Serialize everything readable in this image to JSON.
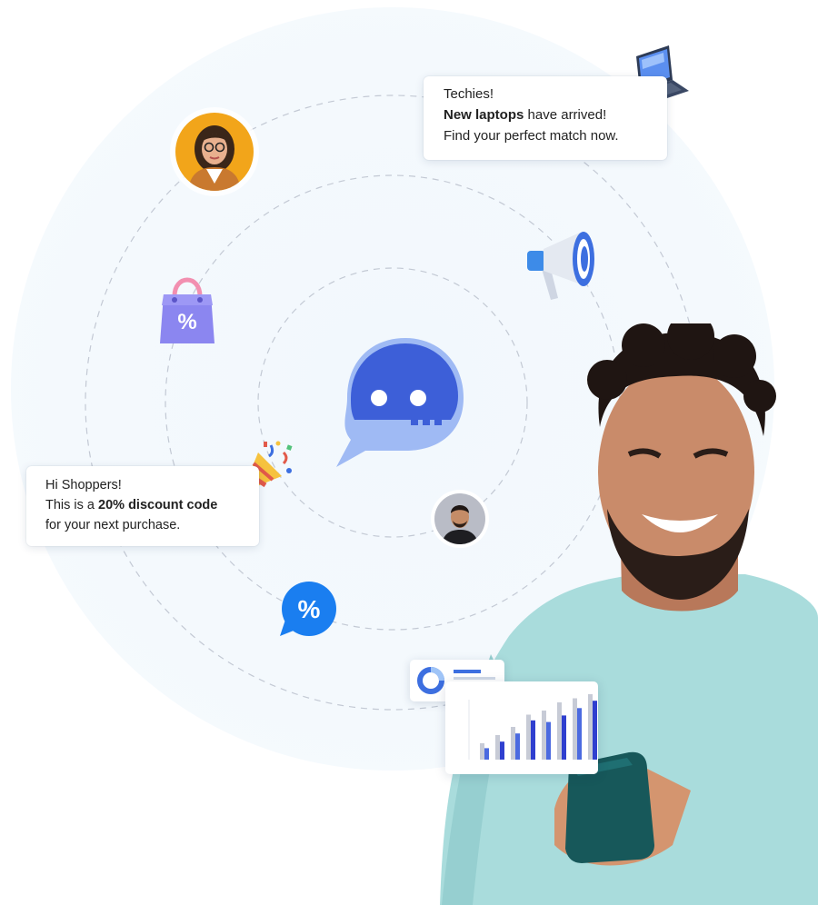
{
  "notifications": {
    "laptops": {
      "line1": "Techies!",
      "line2_bold": "New laptops",
      "line2_rest": " have arrived!",
      "line3": "Find your perfect match now."
    },
    "discount": {
      "line1": "Hi Shoppers!",
      "line2_pre": "This is a ",
      "line2_bold": "20% discount code",
      "line3": "for your next purchase."
    }
  },
  "icons": {
    "central": "chat-bubble-icon",
    "bag": "shopping-bag-percent-icon",
    "megaphone": "megaphone-icon",
    "party": "party-popper-icon",
    "discount_bubble": "percent-chat-icon",
    "laptop": "laptop-icon"
  },
  "badge_symbols": {
    "bag": "%",
    "bubble": "%"
  },
  "colors": {
    "chat_blue": "#3d5fd8",
    "chat_light": "#8fb0f2",
    "bag_purple": "#8b86f0",
    "bubble_blue": "#1a7ef0",
    "orbit": "#bfc6d2"
  },
  "chart_data": {
    "type": "bar",
    "series": [
      {
        "values": [
          2,
          3,
          4,
          5.5,
          6,
          7,
          7.5,
          8
        ]
      },
      {
        "values": [
          1.4,
          2.2,
          3.2,
          4.8,
          4.6,
          5.4,
          6.3,
          7.2
        ]
      }
    ]
  }
}
